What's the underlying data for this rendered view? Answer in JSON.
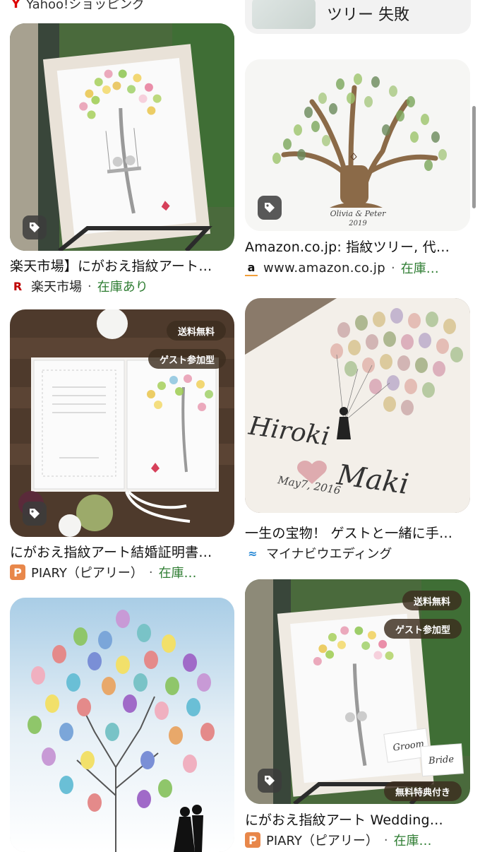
{
  "top_partial": {
    "left_text": "Yahoo!ショッピング",
    "right_text": "ツリー 失敗"
  },
  "results": [
    {
      "title": "楽天市場】にがおえ指紋アート…",
      "source": "楽天市場",
      "stock": "在庫あり",
      "favicon": "R",
      "favicon_color": "#bf0000"
    },
    {
      "title": "Amazon.co.jp: 指紋ツリー, 代…",
      "source": "www.amazon.co.jp",
      "stock": "在庫…",
      "favicon": "a",
      "favicon_color": "#111111",
      "image_caption_1": "Olivia & Peter",
      "image_caption_2": "2019"
    },
    {
      "title": "にがおえ指紋アート結婚証明書…",
      "source": "PIARY（ピアリー）",
      "stock": "在庫…",
      "favicon": "P",
      "favicon_color": "#e8874a",
      "badges": [
        "送料無料",
        "ゲスト参加型"
      ]
    },
    {
      "title": "一生の宝物！ ゲストと一緒に手…",
      "source": "マイナビウエディング",
      "favicon": "≈",
      "favicon_color": "#2a8ad6",
      "image_script_1": "Hiroki",
      "image_script_2": "Maki",
      "image_date": "May7, 2016"
    },
    {
      "title": "",
      "source": ""
    },
    {
      "title": "にがおえ指紋アート Wedding…",
      "source": "PIARY（ピアリー）",
      "stock": "在庫…",
      "favicon": "P",
      "favicon_color": "#e8874a",
      "badges": [
        "送料無料",
        "ゲスト参加型",
        "無料特典付き"
      ],
      "card_1": "Groom",
      "card_2": "Bride"
    }
  ],
  "icons": {
    "tag": "tag-icon"
  }
}
